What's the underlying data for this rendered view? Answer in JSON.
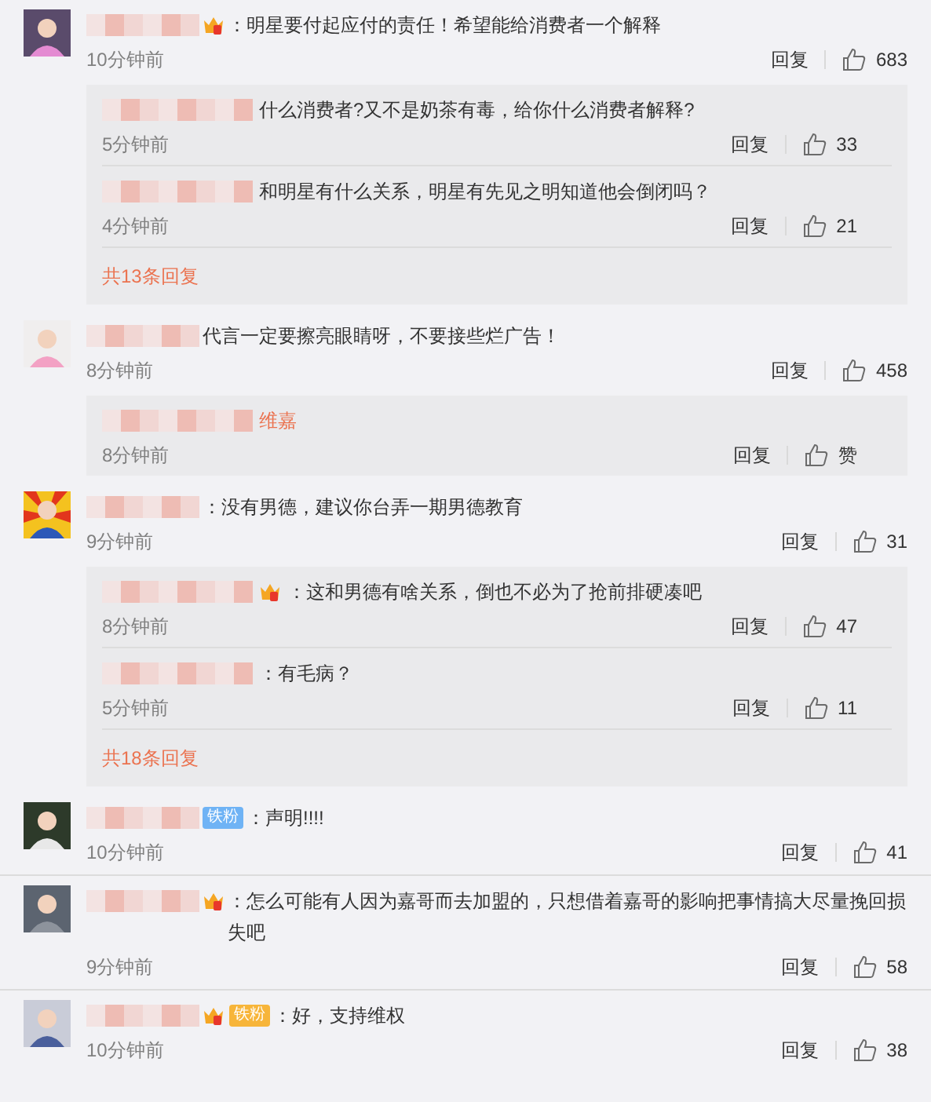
{
  "comments": [
    {
      "badges": [
        {
          "kind": "crown"
        }
      ],
      "text": "：明星要付起应付的责任！希望能给消费者一个解释",
      "time": "10分钟前",
      "reply_label": "回复",
      "likes": "683",
      "replies": [
        {
          "text": "什么消费者?又不是奶茶有毒，给你什么消费者解释?",
          "time": "5分钟前",
          "reply_label": "回复",
          "likes": "33"
        },
        {
          "text": "和明星有什么关系，明星有先见之明知道他会倒闭吗？",
          "time": "4分钟前",
          "reply_label": "回复",
          "likes": "21"
        }
      ],
      "more": "共13条回复"
    },
    {
      "text": "代言一定要擦亮眼睛呀，不要接些烂广告！",
      "time": "8分钟前",
      "reply_label": "回复",
      "likes": "458",
      "replies": [
        {
          "mention": "维嘉",
          "time": "8分钟前",
          "reply_label": "回复",
          "likes": "赞"
        }
      ]
    },
    {
      "text": "：没有男德，建议你台弄一期男德教育",
      "time": "9分钟前",
      "reply_label": "回复",
      "likes": "31",
      "replies": [
        {
          "badges": [
            {
              "kind": "crown"
            }
          ],
          "text": "：这和男德有啥关系，倒也不必为了抢前排硬凑吧",
          "time": "8分钟前",
          "reply_label": "回复",
          "likes": "47"
        },
        {
          "text": "：有毛病？",
          "time": "5分钟前",
          "reply_label": "回复",
          "likes": "11"
        }
      ],
      "more": "共18条回复"
    },
    {
      "badges": [
        {
          "kind": "fan",
          "label": "铁粉",
          "color": "#6fb3f5"
        }
      ],
      "text": "：声明!!!!",
      "time": "10分钟前",
      "reply_label": "回复",
      "likes": "41"
    },
    {
      "badges": [
        {
          "kind": "crown"
        }
      ],
      "text": "：怎么可能有人因为嘉哥而去加盟的，只想借着嘉哥的影响把事情搞大尽量挽回损失吧",
      "time": "9分钟前",
      "reply_label": "回复",
      "likes": "58"
    },
    {
      "badges": [
        {
          "kind": "crownfan",
          "label": "铁粉",
          "color": "#f7b53a"
        }
      ],
      "text": "：好，支持维权",
      "time": "10分钟前",
      "reply_label": "回复",
      "likes": "38"
    }
  ]
}
